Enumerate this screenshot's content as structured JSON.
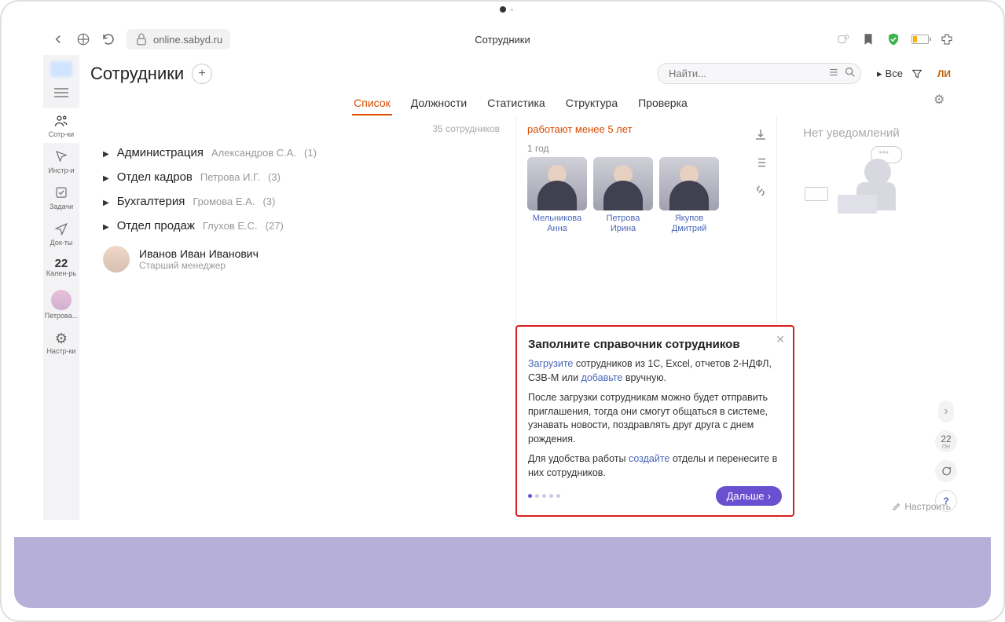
{
  "browser": {
    "url": "online.sabyd.ru",
    "tab_title": "Сотрудники"
  },
  "narrow_sidebar": [
    {
      "label": "Сотр-ки"
    },
    {
      "label": "Инстр-и"
    },
    {
      "label": "Задачи"
    },
    {
      "label": "Док-ты"
    },
    {
      "label": "Кален-рь",
      "num": "22"
    },
    {
      "label": "Петрова..."
    },
    {
      "label": "Настр-ки"
    }
  ],
  "header": {
    "title": "Сотрудники",
    "search_placeholder": "Найти...",
    "filter_label": "Bce",
    "user_short": "ЛИ"
  },
  "tabs": [
    {
      "label": "Список",
      "selected": true
    },
    {
      "label": "Должности"
    },
    {
      "label": "Статистика"
    },
    {
      "label": "Структура"
    },
    {
      "label": "Проверка"
    }
  ],
  "count_hint": "35 сотрудников",
  "departments": [
    {
      "name": "Администрация",
      "head": "Александров С.А.",
      "count": "(1)"
    },
    {
      "name": "Отдел кадров",
      "head": "Петрова И.Г.",
      "count": "(3)"
    },
    {
      "name": "Бухгалтерия",
      "head": "Громова Е.А.",
      "count": "(3)"
    },
    {
      "name": "Отдел продаж",
      "head": "Глухов Е.С.",
      "count": "(27)"
    }
  ],
  "person": {
    "name": "Иванов Иван Иванович",
    "role": "Старший менеджер"
  },
  "side": {
    "title": "работают менее 5 лет",
    "year": "1 год",
    "employees": [
      {
        "name": "Мельникова Анна"
      },
      {
        "name": "Петрова Ирина"
      },
      {
        "name": "Якупов Дмитрий"
      }
    ]
  },
  "notif": {
    "title": "Нет уведомлений"
  },
  "right_dock": {
    "cal": "22",
    "cal_sub": "ПН"
  },
  "settings_link": "Настроить",
  "popover": {
    "title": "Заполните справочник сотрудников",
    "p1_pre": "",
    "link1": "Загрузите",
    "p1_rest": " сотрудников из 1С, Excel, отчетов 2-НДФЛ, СЗВ-М или ",
    "link2": "добавьте",
    "p1_end": " вручную.",
    "p2": "После загрузки сотрудникам можно будет отправить приглашения, тогда они смогут общаться в системе, узнавать новости, поздравлять друг друга с днем рождения.",
    "p3_pre": "Для удобства работы ",
    "link3": "создайте",
    "p3_end": " отделы и перенесите в них сотрудников.",
    "next": "Дальше"
  }
}
